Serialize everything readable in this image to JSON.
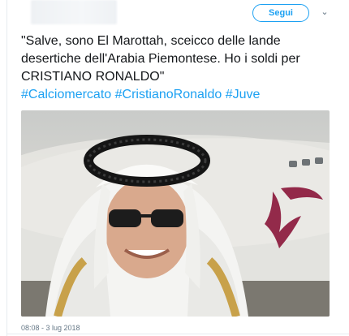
{
  "tweet": {
    "follow_label": "Segui",
    "text": "\"Salve, sono El Marottah, sceicco delle lande desertiche dell'Arabia Piemontese. Ho i soldi per CRISTIANO RONALDO\"",
    "hashtags": [
      "#Calciomercato",
      "#CristianoRonaldo",
      "#Juve"
    ],
    "timestamp": "08:08 - 3 lug 2018"
  },
  "icons": {
    "menu": "chevron-down-icon"
  },
  "colors": {
    "accent": "#1da1f2",
    "text": "#14171a",
    "muted": "#657786",
    "qatar_maroon": "#8a1538"
  }
}
